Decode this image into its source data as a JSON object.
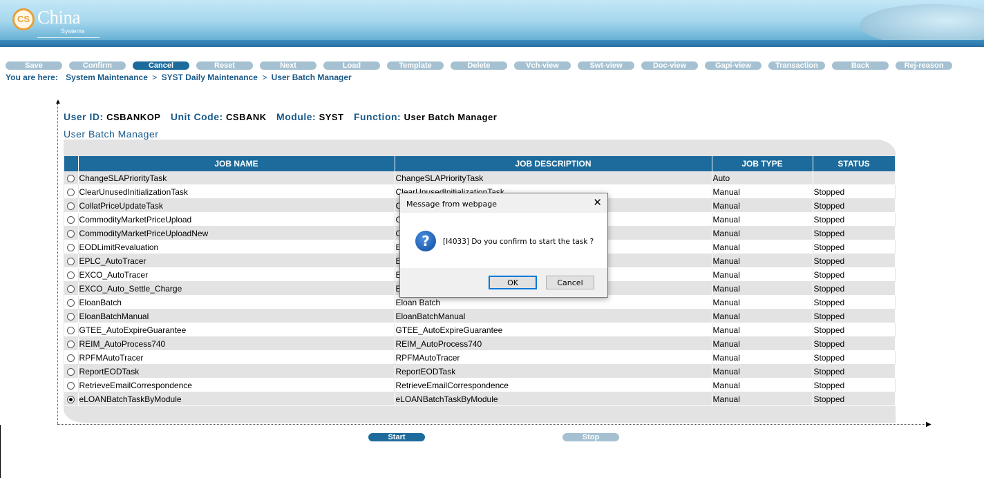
{
  "brand": {
    "logo_mark": "CS",
    "name": "China",
    "sub": "Systems"
  },
  "toolbar": [
    {
      "label": "Save",
      "active": false
    },
    {
      "label": "Confirm",
      "active": false
    },
    {
      "label": "Cancel",
      "active": true
    },
    {
      "label": "Reset",
      "active": false
    },
    {
      "label": "Next",
      "active": false
    },
    {
      "label": "Load",
      "active": false
    },
    {
      "label": "Template",
      "active": false
    },
    {
      "label": "Delete",
      "active": false
    },
    {
      "label": "Vch-view",
      "active": false
    },
    {
      "label": "Swt-view",
      "active": false
    },
    {
      "label": "Doc-view",
      "active": false
    },
    {
      "label": "Gapi-view",
      "active": false
    },
    {
      "label": "Transaction",
      "active": false
    },
    {
      "label": "Back",
      "active": false
    },
    {
      "label": "Rej-reason",
      "active": false
    }
  ],
  "breadcrumb": {
    "prefix": "You are here:",
    "items": [
      "System Maintenance",
      "SYST Daily Maintenance",
      "User Batch Manager"
    ],
    "separator": ">"
  },
  "info": {
    "user_label": "User ID:",
    "user_value": "CSBANKOP",
    "unit_label": "Unit Code:",
    "unit_value": "CSBANK",
    "module_label": "Module:",
    "module_value": "SYST",
    "function_label": "Function:",
    "function_value": "User Batch Manager"
  },
  "section_title": "User Batch Manager",
  "table": {
    "columns": [
      "JOB NAME",
      "JOB DESCRIPTION",
      "JOB TYPE",
      "STATUS"
    ],
    "rows": [
      {
        "name": "ChangeSLAPriorityTask",
        "description": "ChangeSLAPriorityTask",
        "type": "Auto",
        "status": "",
        "selected": false
      },
      {
        "name": "ClearUnusedInitializationTask",
        "description": "ClearUnusedInitializationTask",
        "type": "Manual",
        "status": "Stopped",
        "selected": false
      },
      {
        "name": "CollatPriceUpdateTask",
        "description": "C",
        "type": "Manual",
        "status": "Stopped",
        "selected": false
      },
      {
        "name": "CommodityMarketPriceUpload",
        "description": "C",
        "type": "Manual",
        "status": "Stopped",
        "selected": false
      },
      {
        "name": "CommodityMarketPriceUploadNew",
        "description": "C",
        "type": "Manual",
        "status": "Stopped",
        "selected": false
      },
      {
        "name": "EODLimitRevaluation",
        "description": "E",
        "type": "Manual",
        "status": "Stopped",
        "selected": false
      },
      {
        "name": "EPLC_AutoTracer",
        "description": "E",
        "type": "Manual",
        "status": "Stopped",
        "selected": false
      },
      {
        "name": "EXCO_AutoTracer",
        "description": "E",
        "type": "Manual",
        "status": "Stopped",
        "selected": false
      },
      {
        "name": "EXCO_Auto_Settle_Charge",
        "description": "E",
        "type": "Manual",
        "status": "Stopped",
        "selected": false
      },
      {
        "name": "EloanBatch",
        "description": "Eloan Batch",
        "type": "Manual",
        "status": "Stopped",
        "selected": false
      },
      {
        "name": "EloanBatchManual",
        "description": "EloanBatchManual",
        "type": "Manual",
        "status": "Stopped",
        "selected": false
      },
      {
        "name": "GTEE_AutoExpireGuarantee",
        "description": "GTEE_AutoExpireGuarantee",
        "type": "Manual",
        "status": "Stopped",
        "selected": false
      },
      {
        "name": "REIM_AutoProcess740",
        "description": "REIM_AutoProcess740",
        "type": "Manual",
        "status": "Stopped",
        "selected": false
      },
      {
        "name": "RPFMAutoTracer",
        "description": "RPFMAutoTracer",
        "type": "Manual",
        "status": "Stopped",
        "selected": false
      },
      {
        "name": "ReportEODTask",
        "description": "ReportEODTask",
        "type": "Manual",
        "status": "Stopped",
        "selected": false
      },
      {
        "name": "RetrieveEmailCorrespondence",
        "description": "RetrieveEmailCorrespondence",
        "type": "Manual",
        "status": "Stopped",
        "selected": false
      },
      {
        "name": "eLOANBatchTaskByModule",
        "description": "eLOANBatchTaskByModule",
        "type": "Manual",
        "status": "Stopped",
        "selected": true
      }
    ]
  },
  "actions": {
    "start": "Start",
    "stop": "Stop"
  },
  "dialog": {
    "title": "Message from webpage",
    "close": "✕",
    "icon": "question-icon",
    "icon_glyph": "?",
    "message": "[I4033] Do you confirm to start the task ?",
    "ok": "OK",
    "cancel": "Cancel"
  },
  "colors": {
    "header_blue": "#1c6b9c",
    "label_blue": "#1a5a8a",
    "inactive_button": "#a5c1d1",
    "row_alt": "#e3e3e3"
  }
}
